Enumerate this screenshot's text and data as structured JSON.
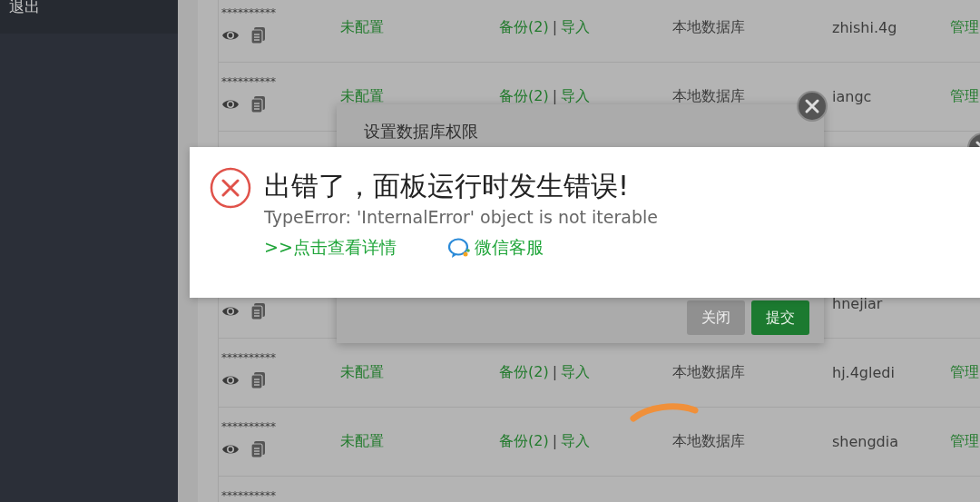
{
  "sidebar": {
    "items": [
      {
        "label": "退出"
      }
    ]
  },
  "table": {
    "rows": [
      {
        "password": "**********",
        "remark": "未配置",
        "backup": "备份(2)",
        "separator": "|",
        "import": "导入",
        "location": "本地数据库",
        "name": "zhishi.4g",
        "action": "管理"
      },
      {
        "password": "**********",
        "remark": "未配置",
        "backup": "备份(2)",
        "separator": "|",
        "import": "导入",
        "location": "本地数据库",
        "name": "iangc",
        "action": "管理"
      },
      {
        "name": "hnejiar"
      },
      {
        "password": "**********",
        "remark": "未配置",
        "backup": "备份(2)",
        "separator": "|",
        "import": "导入",
        "location": "本地数据库",
        "name": "hj.4gledi",
        "action": "管理"
      },
      {
        "password": "**********",
        "remark": "未配置",
        "backup": "备份(2)",
        "separator": "|",
        "import": "导入",
        "location": "本地数据库",
        "name": "shengdia",
        "action": "管理"
      },
      {
        "password": "**********"
      }
    ]
  },
  "dialog": {
    "title": "设置数据库权限",
    "buttons": [
      {
        "label": "关闭",
        "kind": "secondary"
      },
      {
        "label": "提交",
        "kind": "primary"
      }
    ]
  },
  "error": {
    "title": "出错了，面板运行时发生错误!",
    "message": "TypeError: 'InternalError' object is not iterable",
    "links": [
      {
        "label": ">>点击查看详情",
        "kind": "details"
      },
      {
        "label": "微信客服",
        "kind": "wechat"
      }
    ]
  }
}
